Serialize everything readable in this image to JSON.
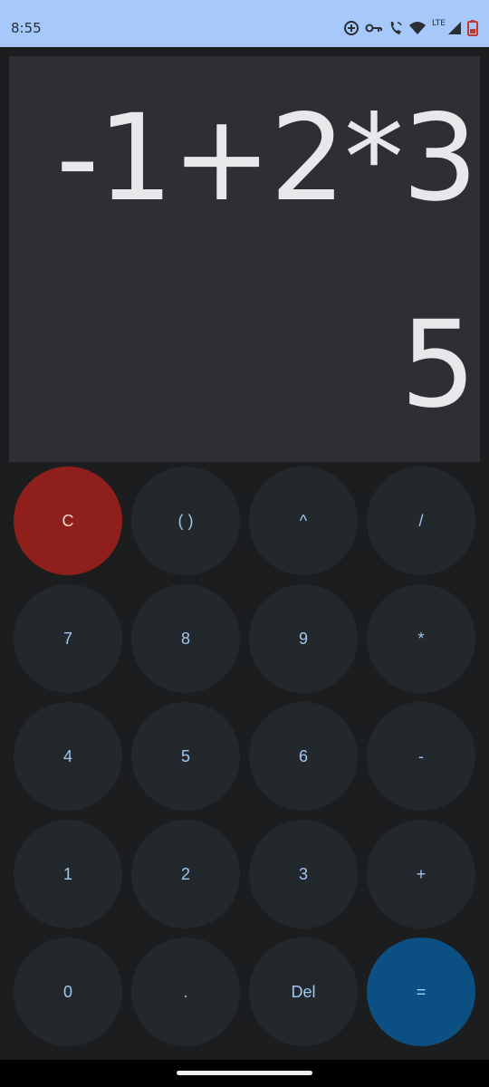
{
  "status_bar": {
    "time": "8:55",
    "network_label": "LTE",
    "icons": [
      "data-saver-icon",
      "vpn-key-icon",
      "wifi-calling-icon",
      "wifi-icon",
      "cell-signal-icon",
      "battery-icon"
    ]
  },
  "display": {
    "expression": "-1+2*3",
    "result": "5"
  },
  "keys": [
    {
      "name": "clear-button",
      "label": "C",
      "type": "clear"
    },
    {
      "name": "parentheses-button",
      "label": "( )",
      "type": "op"
    },
    {
      "name": "power-button",
      "label": "^",
      "type": "op"
    },
    {
      "name": "divide-button",
      "label": "/",
      "type": "op"
    },
    {
      "name": "seven-button",
      "label": "7",
      "type": "digit"
    },
    {
      "name": "eight-button",
      "label": "8",
      "type": "digit"
    },
    {
      "name": "nine-button",
      "label": "9",
      "type": "digit"
    },
    {
      "name": "multiply-button",
      "label": "*",
      "type": "op"
    },
    {
      "name": "four-button",
      "label": "4",
      "type": "digit"
    },
    {
      "name": "five-button",
      "label": "5",
      "type": "digit"
    },
    {
      "name": "six-button",
      "label": "6",
      "type": "digit"
    },
    {
      "name": "minus-button",
      "label": "-",
      "type": "op"
    },
    {
      "name": "one-button",
      "label": "1",
      "type": "digit"
    },
    {
      "name": "two-button",
      "label": "2",
      "type": "digit"
    },
    {
      "name": "three-button",
      "label": "3",
      "type": "digit"
    },
    {
      "name": "plus-button",
      "label": "+",
      "type": "op"
    },
    {
      "name": "zero-button",
      "label": "0",
      "type": "digit"
    },
    {
      "name": "decimal-button",
      "label": ".",
      "type": "digit"
    },
    {
      "name": "delete-button",
      "label": "Del",
      "type": "op"
    },
    {
      "name": "equals-button",
      "label": "=",
      "type": "equals"
    }
  ],
  "colors": {
    "status_bar": "#a6c8fb",
    "display_bg": "#2e2f34",
    "key_bg": "#23282d",
    "key_text": "#9fc8f2",
    "clear_key": "#8f1f1a",
    "equals_key": "#0b4f83"
  }
}
